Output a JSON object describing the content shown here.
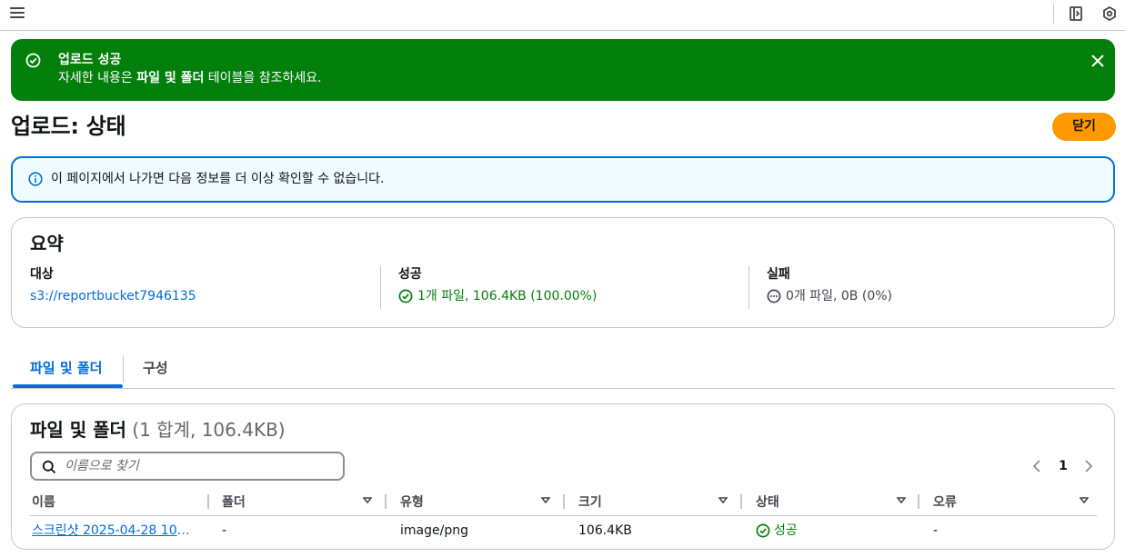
{
  "topbar": {
    "menu_icon": "hamburger-icon",
    "panel_icon": "side-panel-icon",
    "hex_icon": "cloudshell-hexagon-icon"
  },
  "flash": {
    "title": "업로드 성공",
    "body_prefix": "자세한 내용은 ",
    "body_bold": "파일 및 폴더",
    "body_suffix": " 테이블을 참조하세요.",
    "icon": "check-circle-icon",
    "close_icon": "close-icon",
    "color": "#037f0c"
  },
  "page": {
    "title": "업로드: 상태",
    "close_button": "닫기"
  },
  "info_alert": {
    "text": "이 페이지에서 나가면 다음 정보를 더 이상 확인할 수 없습니다.",
    "icon": "info-icon"
  },
  "summary": {
    "heading": "요약",
    "destination_label": "대상",
    "destination_value": "s3://reportbucket7946135",
    "success_label": "성공",
    "success_value": "1개 파일, 106.4KB (100.00%)",
    "failed_label": "실패",
    "failed_value": "0개 파일, 0B (0%)"
  },
  "tabs": [
    {
      "label": "파일 및 폴더",
      "active": true
    },
    {
      "label": "구성",
      "active": false
    }
  ],
  "files": {
    "heading": "파일 및 폴더",
    "count": "(1 합계, 106.4KB)",
    "search_placeholder": "이름으로 찾기",
    "page_number": "1",
    "columns": [
      "이름",
      "폴더",
      "유형",
      "크기",
      "상태",
      "오류"
    ],
    "rows": [
      {
        "name": "스크린샷 2025-04-28 103...",
        "folder": "-",
        "type": "image/png",
        "size": "106.4KB",
        "status": "성공",
        "error": "-"
      }
    ]
  }
}
